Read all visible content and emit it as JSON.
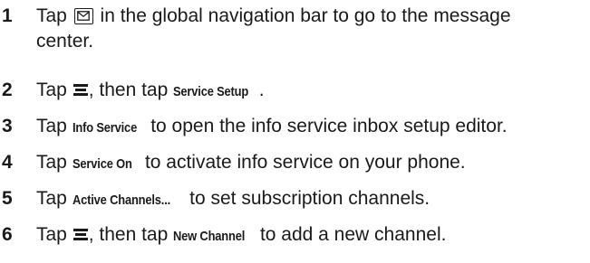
{
  "steps": [
    {
      "number": "1",
      "before_icon": "Tap",
      "icon": "message-envelope-icon",
      "after_icon_line1": "in the global navigation bar to go to the message",
      "line2": "center."
    },
    {
      "number": "2",
      "before_icon": "Tap",
      "icon": "menu-icon",
      "middle": ", then tap",
      "keyword": "Service Setup",
      "after": "."
    },
    {
      "number": "3",
      "before": "Tap",
      "keyword": "Info Service",
      "after": "to open the info service inbox setup editor."
    },
    {
      "number": "4",
      "before": "Tap",
      "keyword": "Service On",
      "after": "to activate info service on your phone."
    },
    {
      "number": "5",
      "before": "Tap",
      "keyword": "Active Channels...",
      "after": "to set subscription channels."
    },
    {
      "number": "6",
      "before_icon": "Tap",
      "icon": "menu-icon",
      "middle": ", then tap",
      "keyword": "New Channel",
      "after": "to add a new channel."
    }
  ]
}
